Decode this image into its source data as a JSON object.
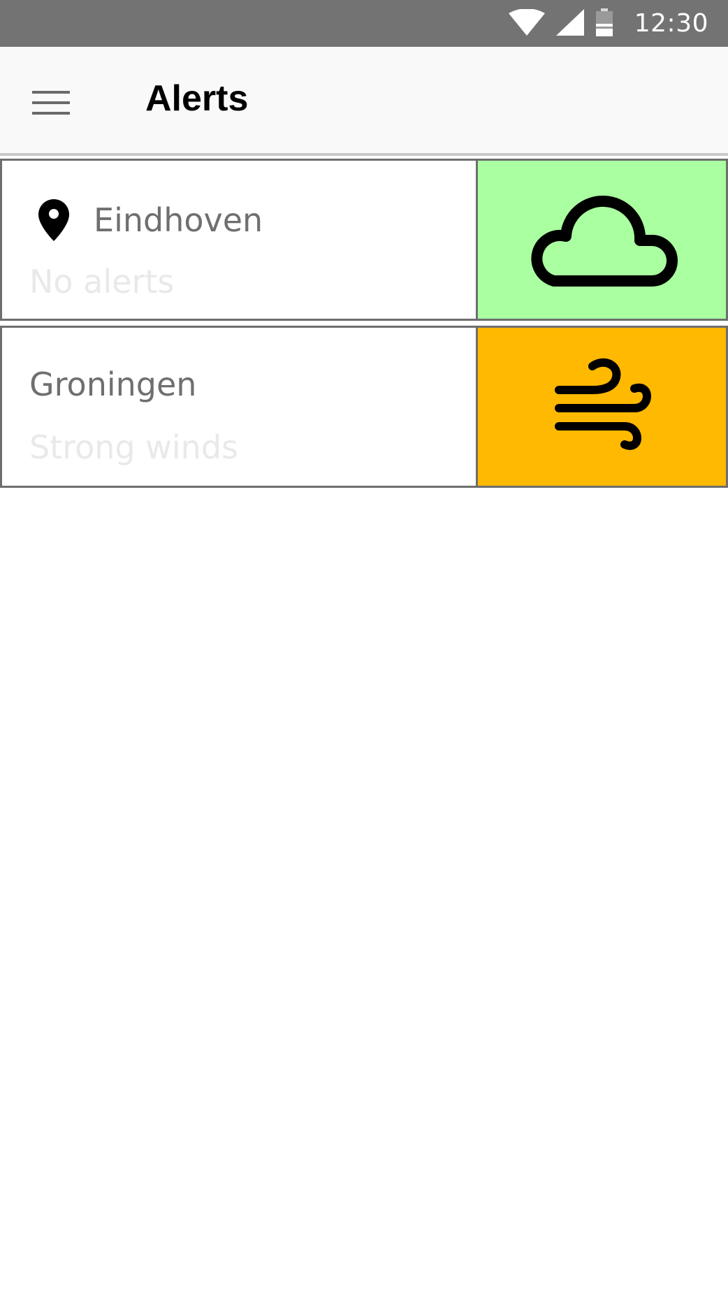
{
  "status_bar": {
    "time": "12:30",
    "icons": [
      "wifi-icon",
      "signal-icon",
      "battery-icon"
    ],
    "background": "#737373"
  },
  "app_bar": {
    "title": "Alerts",
    "menu_icon": "menu-icon",
    "background": "#f9f9f9"
  },
  "alerts": [
    {
      "city": "Eindhoven",
      "status": "No alerts",
      "is_current_location": true,
      "weather_icon": "cloud-icon",
      "tile_color": "#aaffa0"
    },
    {
      "city": "Groningen",
      "status": "Strong winds",
      "is_current_location": false,
      "weather_icon": "wind-icon",
      "tile_color": "#ffb900"
    }
  ]
}
